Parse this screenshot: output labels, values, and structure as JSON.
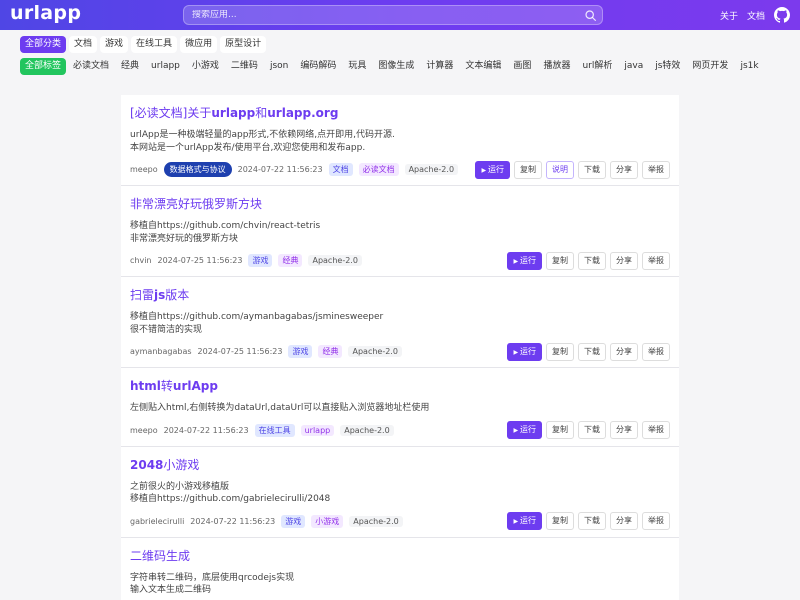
{
  "header": {
    "logo": "urlapp",
    "search_placeholder": "搜索应用...",
    "nav_about": "关于",
    "nav_docs": "文档"
  },
  "categories": [
    "全部分类",
    "文档",
    "游戏",
    "在线工具",
    "微应用",
    "原型设计"
  ],
  "tags": [
    "全部标签",
    "必读文档",
    "经典",
    "urlapp",
    "小游戏",
    "二维码",
    "json",
    "编码解码",
    "玩具",
    "图像生成",
    "计算器",
    "文本编辑",
    "画图",
    "播放器",
    "url解析",
    "java",
    "js特效",
    "网页开发",
    "js1k"
  ],
  "actions": {
    "run": "运行",
    "copy": "复制",
    "explain": "说明",
    "download": "下载",
    "share": "分享",
    "report": "举报"
  },
  "apps": [
    {
      "title_parts": [
        "[必读文档]关于",
        "urlapp",
        "和",
        "urlapp.org"
      ],
      "desc": [
        "urlApp是一种极端轻量的app形式,不依赖网络,点开即用,代码开源.",
        "本网站是一个urlApp发布/使用平台,欢迎您使用和发布app."
      ],
      "author": "meepo",
      "pill": "数据格式与协议",
      "date": "2024-07-22 11:56:23",
      "category": "文档",
      "tag": "必读文档",
      "license": "Apache-2.0",
      "has_explain": true
    },
    {
      "title_parts": [
        "非常漂亮好玩俄罗斯方块"
      ],
      "desc": [
        "移植自https://github.com/chvin/react-tetris",
        "非常漂亮好玩的俄罗斯方块"
      ],
      "author": "chvin",
      "date": "2024-07-25 11:56:23",
      "category": "游戏",
      "tag": "经典",
      "license": "Apache-2.0"
    },
    {
      "title_parts": [
        "扫雷",
        "js",
        "版本"
      ],
      "desc": [
        "移植自https://github.com/aymanbagabas/jsminesweeper",
        "很不错简洁的实现"
      ],
      "author": "aymanbagabas",
      "date": "2024-07-25 11:56:23",
      "category": "游戏",
      "tag": "经典",
      "license": "Apache-2.0"
    },
    {
      "title_parts": [
        "html",
        "转",
        "urlApp"
      ],
      "desc": [
        "左侧贴入html,右侧转换为dataUrl,dataUrl可以直接贴入浏览器地址栏使用"
      ],
      "author": "meepo",
      "date": "2024-07-22 11:56:23",
      "category": "在线工具",
      "tag": "urlapp",
      "license": "Apache-2.0"
    },
    {
      "title_parts": [
        "2048",
        "小游戏"
      ],
      "desc": [
        "之前很火的小游戏移植版",
        "移植自https://github.com/gabrielecirulli/2048"
      ],
      "author": "gabrielecirulli",
      "date": "2024-07-22 11:56:23",
      "category": "游戏",
      "tag": "小游戏",
      "license": "Apache-2.0"
    },
    {
      "title_parts": [
        "二维码生成"
      ],
      "desc": [
        "字符串转二维码，底层使用qrcodejs实现",
        "输入文本生成二维码"
      ],
      "author": "",
      "date": "",
      "category": "",
      "tag": "",
      "license": ""
    }
  ],
  "colors": {
    "accent": "#6d3cf0",
    "green": "#22c55e",
    "pill": "#1e40af"
  }
}
